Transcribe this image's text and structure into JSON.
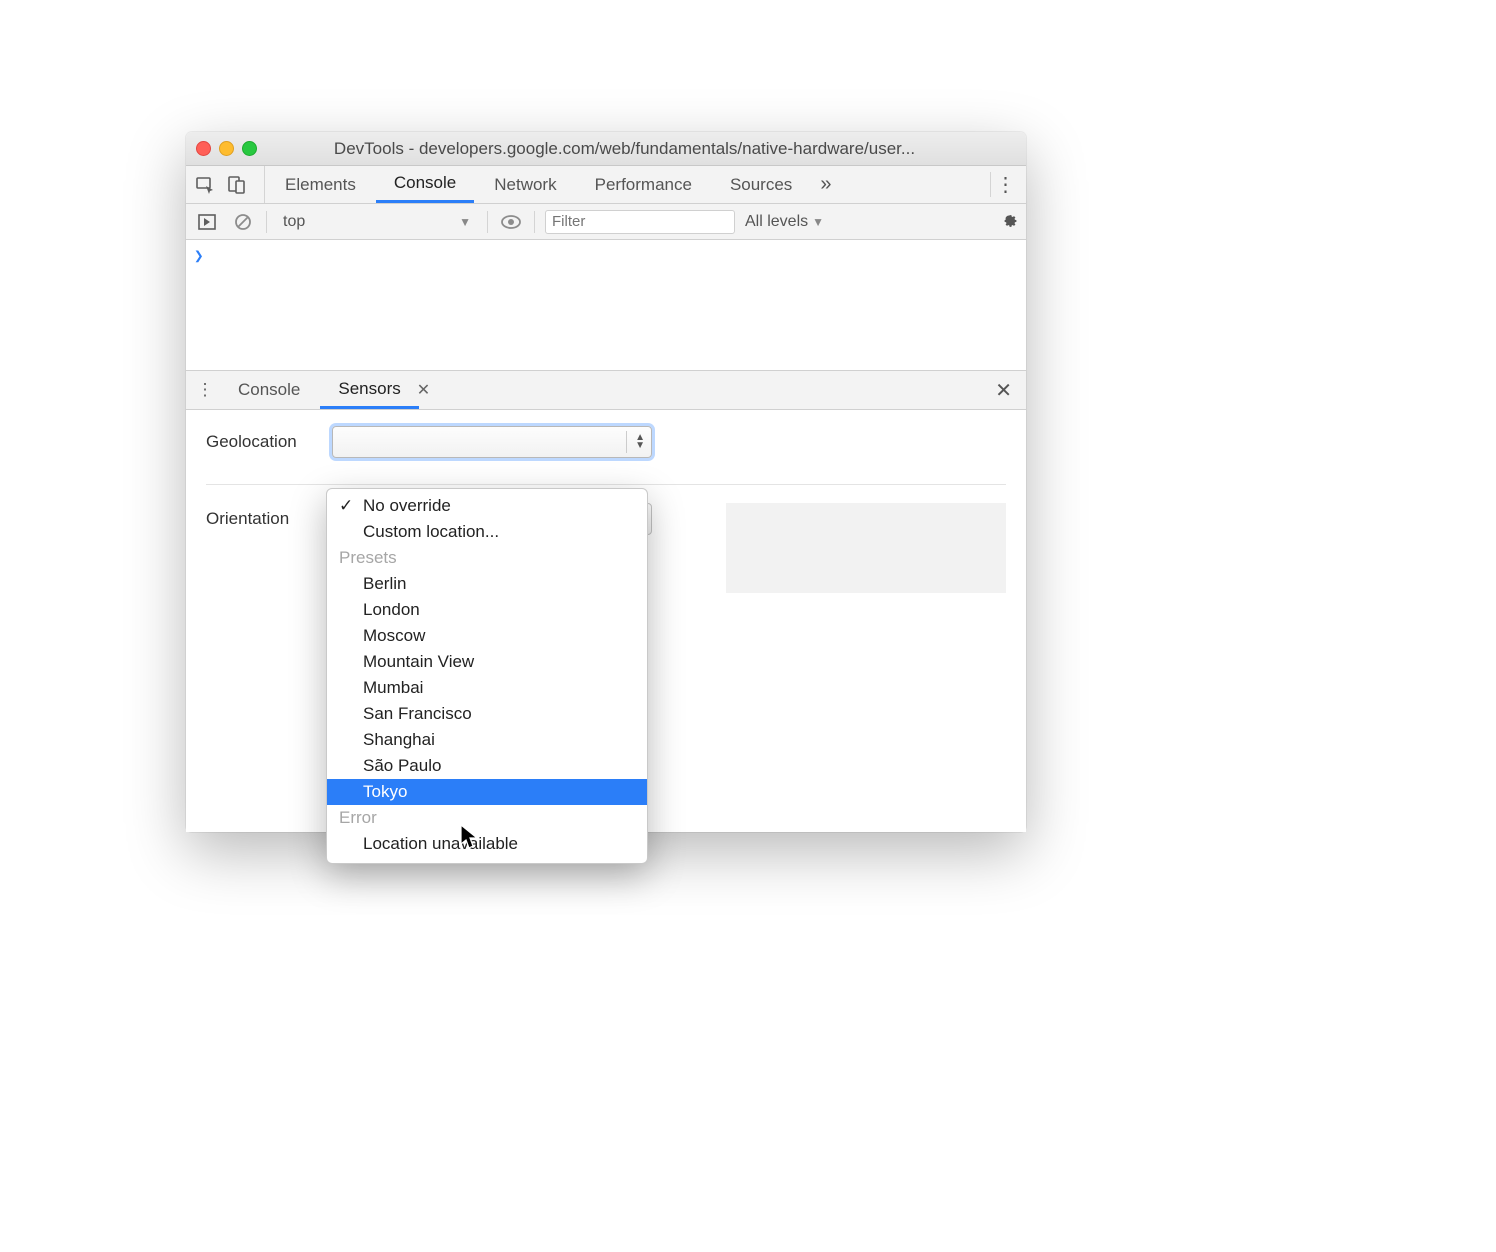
{
  "window": {
    "title": "DevTools - developers.google.com/web/fundamentals/native-hardware/user..."
  },
  "tabs": {
    "elements": "Elements",
    "console": "Console",
    "network": "Network",
    "performance": "Performance",
    "sources": "Sources"
  },
  "console_toolbar": {
    "context": "top",
    "filter_placeholder": "Filter",
    "levels": "All levels"
  },
  "drawer": {
    "tab_console": "Console",
    "tab_sensors": "Sensors"
  },
  "sensors": {
    "geolocation_label": "Geolocation",
    "orientation_label": "Orientation"
  },
  "geo_dropdown": {
    "no_override": "No override",
    "custom": "Custom location...",
    "group_presets": "Presets",
    "presets": {
      "berlin": "Berlin",
      "london": "London",
      "moscow": "Moscow",
      "mountain_view": "Mountain View",
      "mumbai": "Mumbai",
      "san_francisco": "San Francisco",
      "shanghai": "Shanghai",
      "sao_paulo": "São Paulo",
      "tokyo": "Tokyo"
    },
    "group_error": "Error",
    "location_unavailable": "Location unavailable"
  }
}
